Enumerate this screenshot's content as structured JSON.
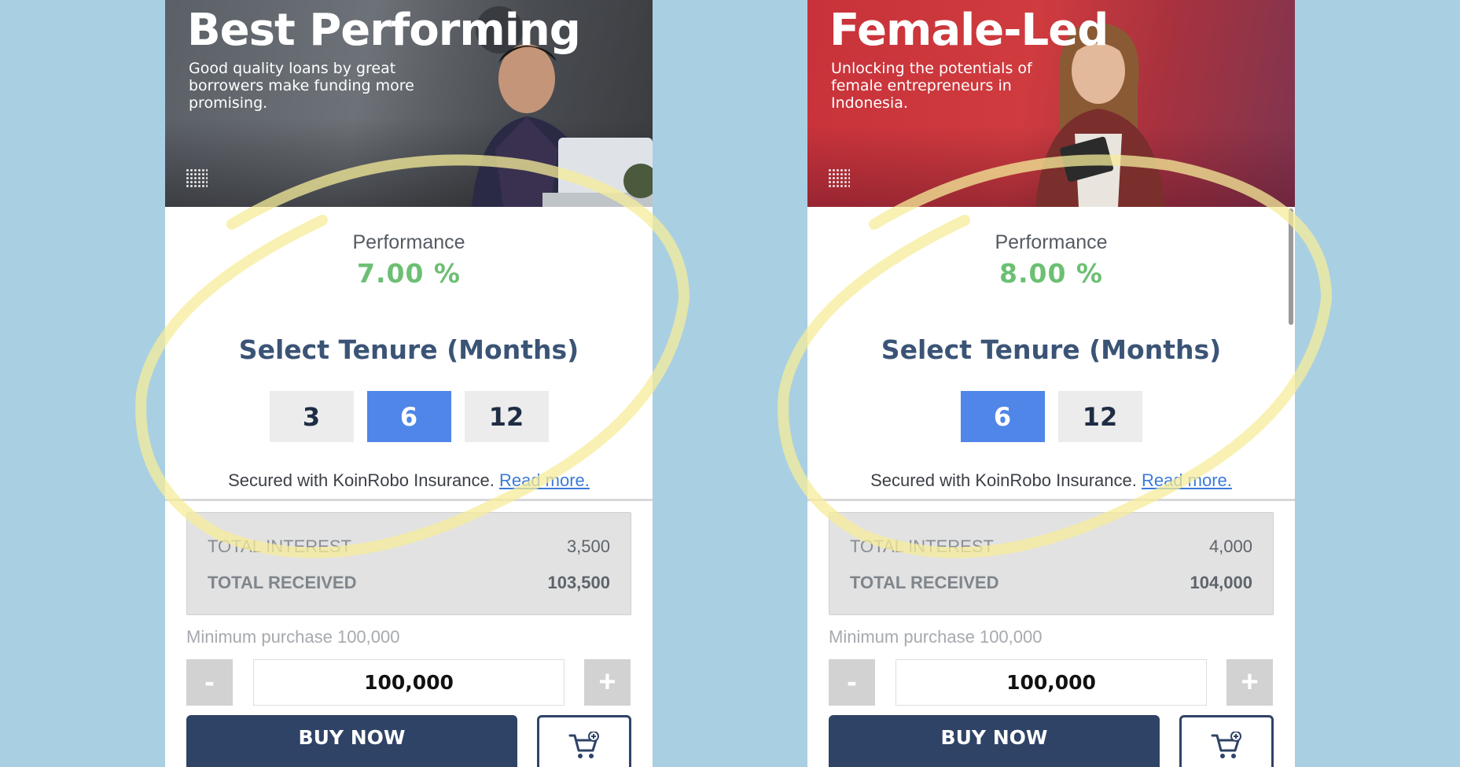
{
  "cards": [
    {
      "banner_title": "Best Performing",
      "banner_desc": "Good quality loans by great borrowers make funding more promising.",
      "perf_label": "Performance",
      "perf_value": "7.00  %",
      "tenure_title": "Select Tenure (Months)",
      "tenures": [
        "3",
        "6",
        "12"
      ],
      "selected_tenure": "6",
      "insured_text": "Secured with KoinRobo Insurance. ",
      "read_more": "Read more.",
      "total_interest_label": "TOTAL INTEREST",
      "total_interest_value": "3,500",
      "total_received_label": "TOTAL RECEIVED",
      "total_received_value": "103,500",
      "minimum_text": "Minimum purchase 100,000",
      "quantity": "100,000",
      "minus_label": "-",
      "plus_label": "+",
      "buy_label": "BUY NOW"
    },
    {
      "banner_title": "Female-Led",
      "banner_desc": "Unlocking the potentials of female entrepreneurs in Indonesia.",
      "perf_label": "Performance",
      "perf_value": "8.00  %",
      "tenure_title": "Select Tenure (Months)",
      "tenures": [
        "6",
        "12"
      ],
      "selected_tenure": "6",
      "insured_text": "Secured with KoinRobo Insurance. ",
      "read_more": "Read more.",
      "total_interest_label": "TOTAL INTEREST",
      "total_interest_value": "4,000",
      "total_received_label": "TOTAL RECEIVED",
      "total_received_value": "104,000",
      "minimum_text": "Minimum purchase 100,000",
      "quantity": "100,000",
      "minus_label": "-",
      "plus_label": "+",
      "buy_label": "BUY NOW"
    }
  ],
  "colors": {
    "background": "#a9cfe3",
    "performance_green": "#6cbf73",
    "tenure_active": "#4f86e8",
    "navy": "#2f4366",
    "highlight_yellow": "#f7eea0"
  },
  "icons": [
    "cart-plus-icon",
    "dots-grid-icon"
  ]
}
